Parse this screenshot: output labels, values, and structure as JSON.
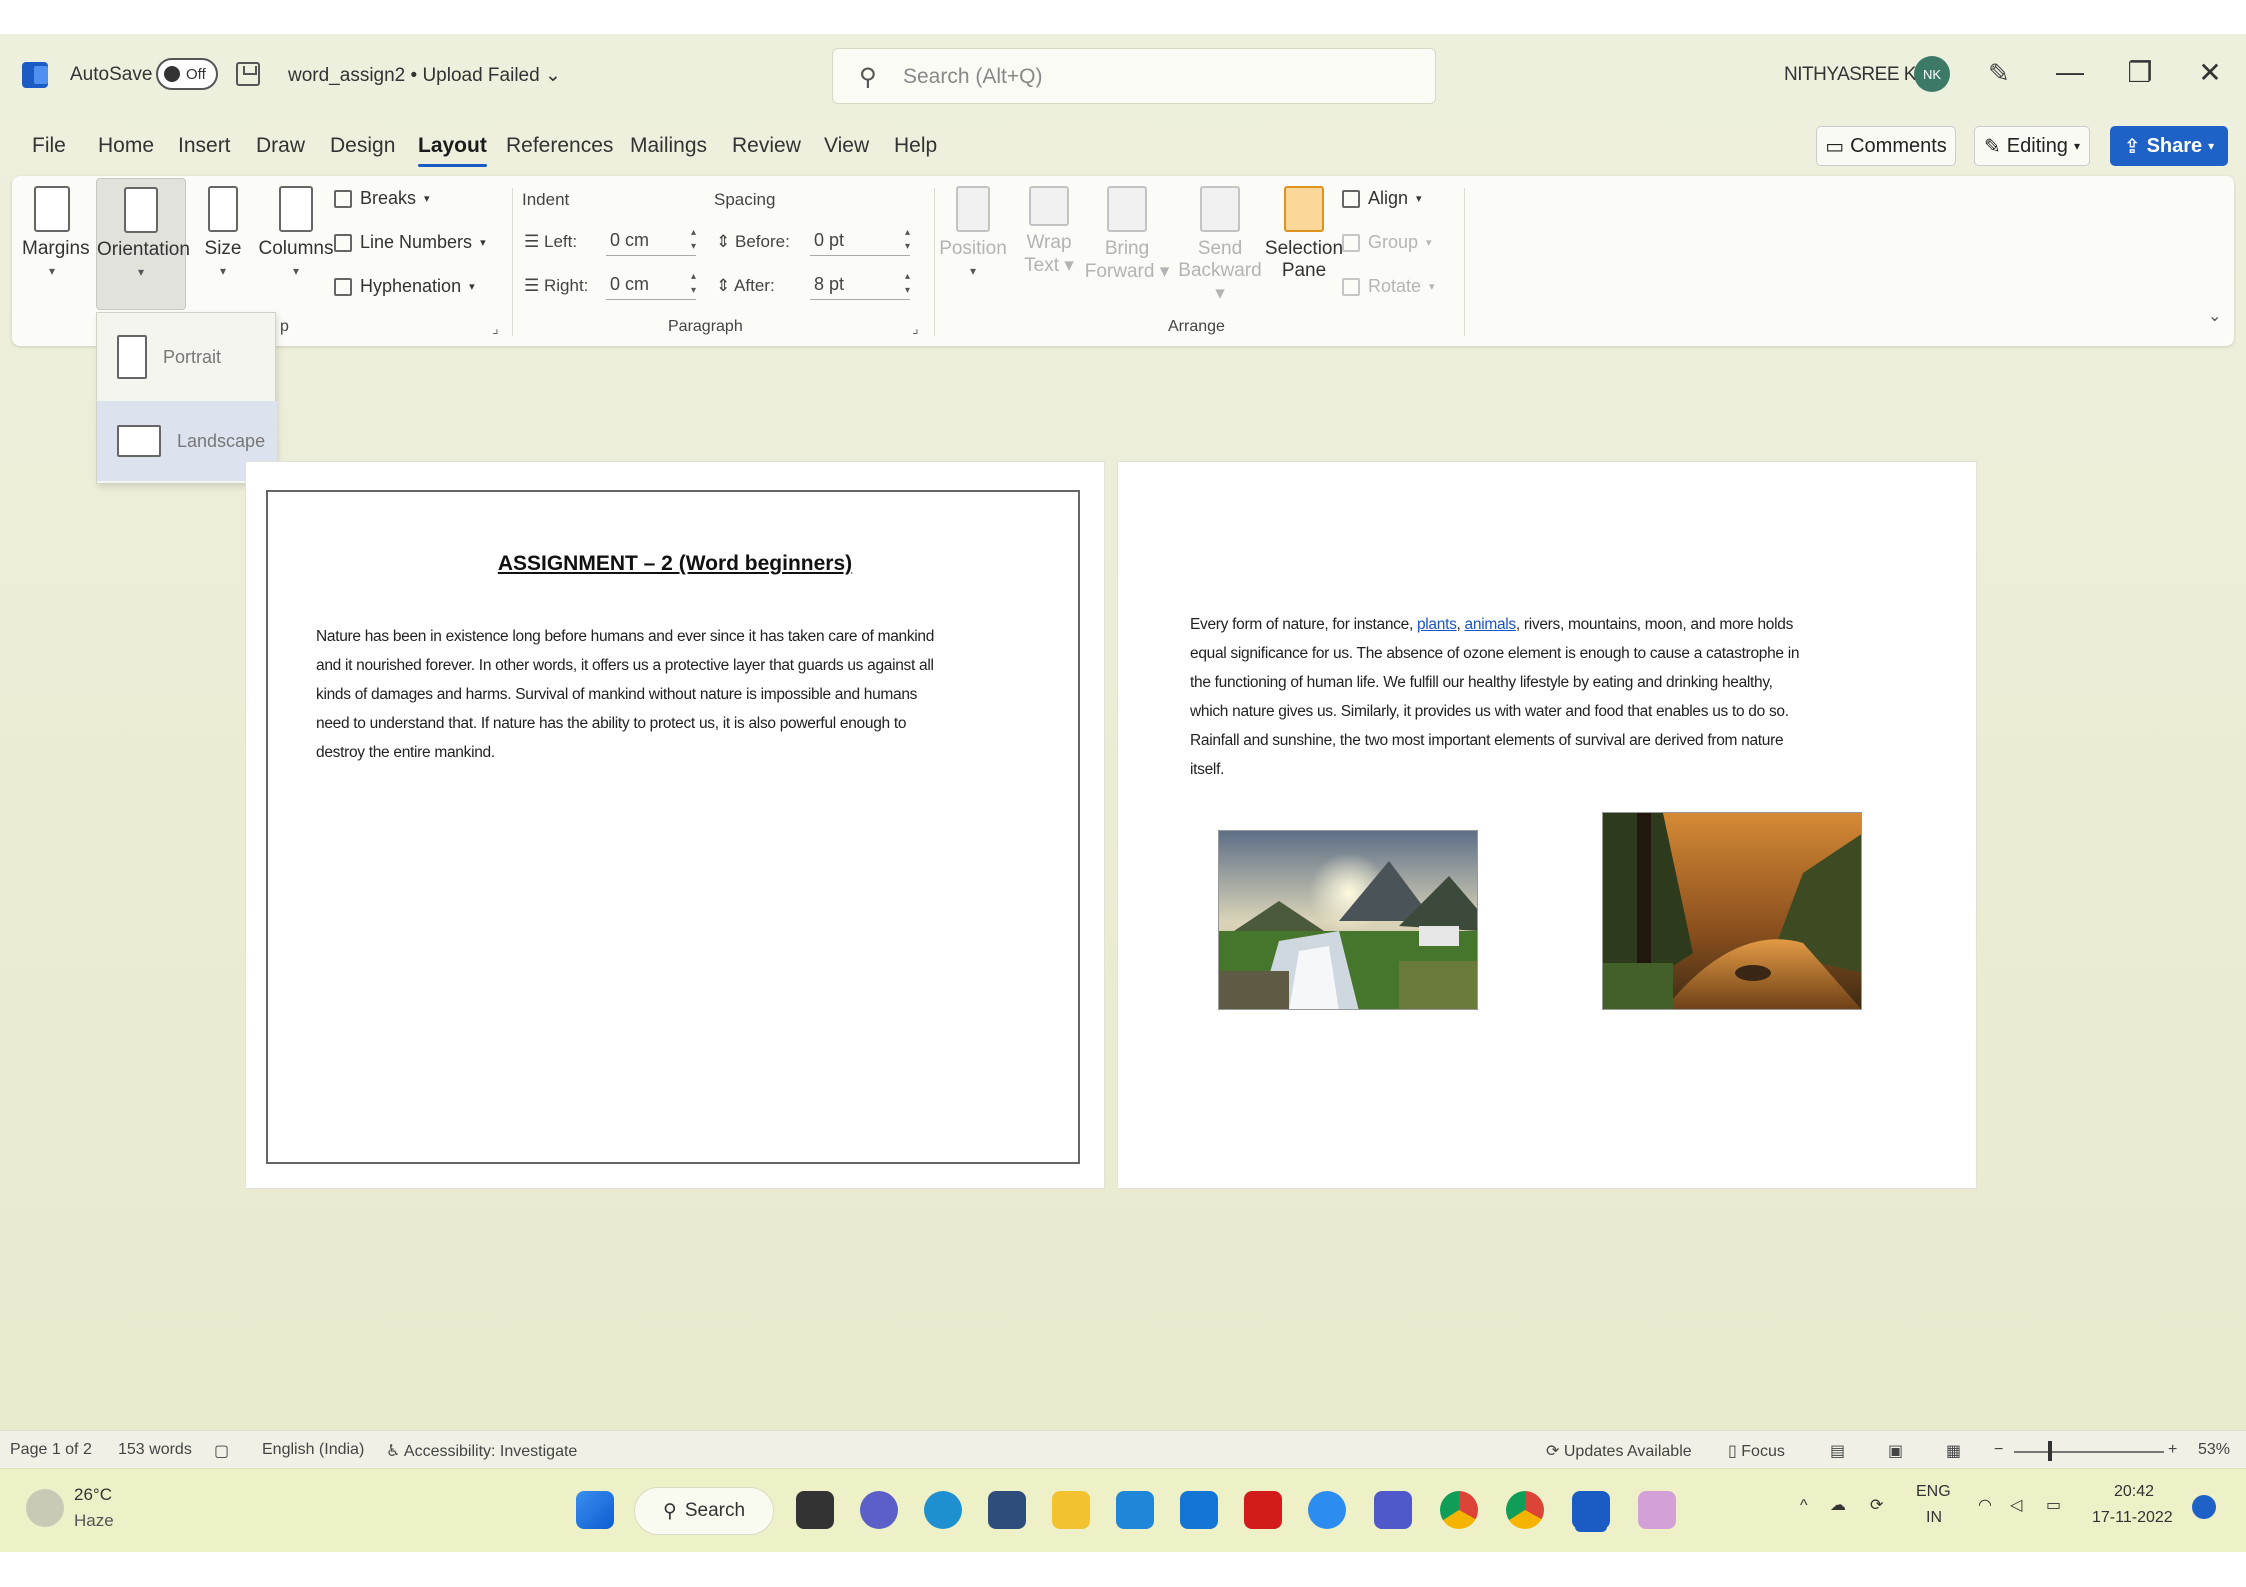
{
  "titlebar": {
    "autosave_label": "AutoSave",
    "autosave_state": "Off",
    "doc_title": "word_assign2 • Upload Failed ⌄",
    "search_placeholder": "Search (Alt+Q)",
    "user_name": "NITHYASREE K",
    "avatar_initials": "NK",
    "minimize": "—",
    "restore": "❐",
    "close": "✕"
  },
  "tabs": [
    "File",
    "Home",
    "Insert",
    "Draw",
    "Design",
    "Layout",
    "References",
    "Mailings",
    "Review",
    "View",
    "Help"
  ],
  "active_tab": "Layout",
  "actions": {
    "comments": "Comments",
    "editing": "Editing",
    "share": "Share"
  },
  "ribbon": {
    "page_setup": {
      "margins": "Margins",
      "orientation": "Orientation",
      "size": "Size",
      "columns": "Columns",
      "breaks": "Breaks",
      "line_numbers": "Line Numbers",
      "hyphenation": "Hyphenation",
      "group_label": "p"
    },
    "paragraph": {
      "indent_heading": "Indent",
      "spacing_heading": "Spacing",
      "left_label": "Left:",
      "left_value": "0 cm",
      "right_label": "Right:",
      "right_value": "0 cm",
      "before_label": "Before:",
      "before_value": "0 pt",
      "after_label": "After:",
      "after_value": "8 pt",
      "group_label": "Paragraph"
    },
    "arrange": {
      "position": "Position",
      "wrap_text_1": "Wrap",
      "wrap_text_2": "Text",
      "bring_forward_1": "Bring",
      "bring_forward_2": "Forward",
      "send_backward_1": "Send",
      "send_backward_2": "Backward",
      "selection_pane_1": "Selection",
      "selection_pane_2": "Pane",
      "align": "Align",
      "group": "Group",
      "rotate": "Rotate",
      "group_label": "Arrange"
    }
  },
  "orientation_menu": {
    "portrait": "Portrait",
    "landscape": "Landscape"
  },
  "document": {
    "heading": "ASSIGNMENT – 2 (Word beginners)",
    "page1_lines": [
      "Nature has been in existence long before humans and ever since it has taken care of mankind",
      "and it nourished forever. In other words, it offers us a protective layer that guards us against all",
      "kinds of damages and harms. Survival of mankind without nature is impossible and humans",
      "need to understand that. If nature has the ability to protect us, it is also powerful enough to",
      "destroy the entire mankind."
    ],
    "page2_line1_a": "Every form of nature, for instance, ",
    "page2_link1": "plants",
    "page2_line1_b": ", ",
    "page2_link2": "animals",
    "page2_line1_c": ", rivers, mountains, moon, and more holds",
    "page2_lines": [
      "equal significance for us.  The absence of ozone element is enough to cause a catastrophe in",
      "the functioning of human life. We fulfill our healthy lifestyle by eating and drinking healthy,",
      "which nature gives us. Similarly, it provides us with water and food that enables us to do so.",
      "Rainfall and sunshine, the two most important elements of survival are derived from nature",
      "itself."
    ]
  },
  "statusbar": {
    "page": "Page 1 of 2",
    "words": "153 words",
    "language": "English (India)",
    "accessibility": "Accessibility: Investigate",
    "updates": "Updates Available",
    "focus": "Focus",
    "zoom": "53%"
  },
  "taskbar": {
    "temperature": "26°C",
    "weather": "Haze",
    "search": "Search",
    "lang_1": "ENG",
    "lang_2": "IN",
    "time": "20:42",
    "date": "17-11-2022"
  },
  "colors": {
    "accent": "#1e62c8",
    "background": "#eceed5",
    "ribbon": "#fbfbf7",
    "taskbar": "#eef0c8"
  }
}
